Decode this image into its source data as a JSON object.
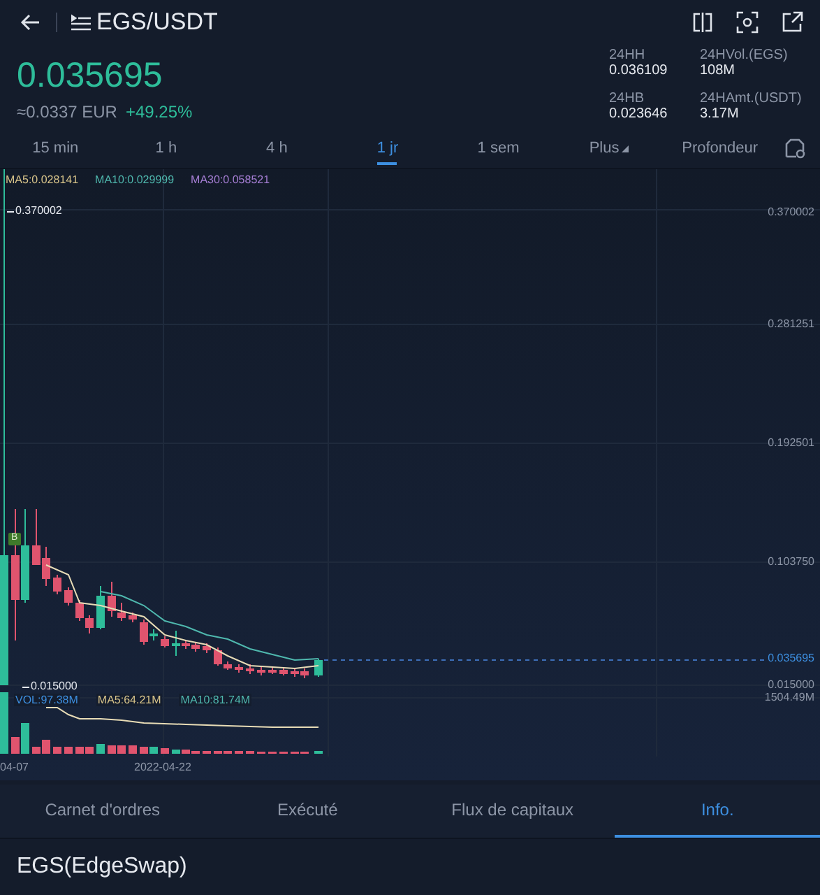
{
  "header": {
    "title": "EGS/USDT"
  },
  "price": {
    "last": "0.035695",
    "fiat": "≈0.0337 EUR",
    "change": "+49.25%"
  },
  "stats": [
    {
      "label": "24HH",
      "value": "0.036109"
    },
    {
      "label": "24HVol.(EGS)",
      "value": "108M"
    },
    {
      "label": "24HB",
      "value": "0.023646"
    },
    {
      "label": "24HAmt.(USDT)",
      "value": "3.17M"
    }
  ],
  "intervals": [
    {
      "label": "15 min",
      "kind": "interval",
      "selected": false
    },
    {
      "label": "1 h",
      "kind": "interval",
      "selected": false
    },
    {
      "label": "4 h",
      "kind": "interval",
      "selected": false
    },
    {
      "label": "1 jr",
      "kind": "interval",
      "selected": true
    },
    {
      "label": "1 sem",
      "kind": "interval",
      "selected": false
    },
    {
      "label": "Plus",
      "kind": "dropdown",
      "selected": false
    },
    {
      "label": "Profondeur",
      "kind": "interval",
      "selected": false
    }
  ],
  "chart": {
    "ma": [
      {
        "label": "MA5:0.028141",
        "color": "#d8c48a"
      },
      {
        "label": "MA10:0.029999",
        "color": "#4fb8ae"
      },
      {
        "label": "MA30:0.058521",
        "color": "#a77fd6"
      }
    ],
    "high_label": "0.370002",
    "low_label": "0.015000",
    "axis_labels": [
      "0.370002",
      "0.281251",
      "0.192501",
      "0.103750"
    ],
    "last_price": "0.035695",
    "axis_low": "0.015000",
    "volume_legend": [
      {
        "label": "VOL:97.38M",
        "color": "#3d8fe0"
      },
      {
        "label": "MA5:64.21M",
        "color": "#d8c48a"
      },
      {
        "label": "MA10:81.74M",
        "color": "#4fb8ae"
      }
    ],
    "volume_max": "1504.49M",
    "dates": [
      "04-07",
      "2022-04-22"
    ],
    "marker": "B"
  },
  "tabs": [
    {
      "label": "Carnet d'ordres",
      "selected": false
    },
    {
      "label": "Exécuté",
      "selected": false
    },
    {
      "label": "Flux de capitaux",
      "selected": false
    },
    {
      "label": "Info.",
      "selected": true
    }
  ],
  "asset_title": "EGS(EdgeSwap)"
}
